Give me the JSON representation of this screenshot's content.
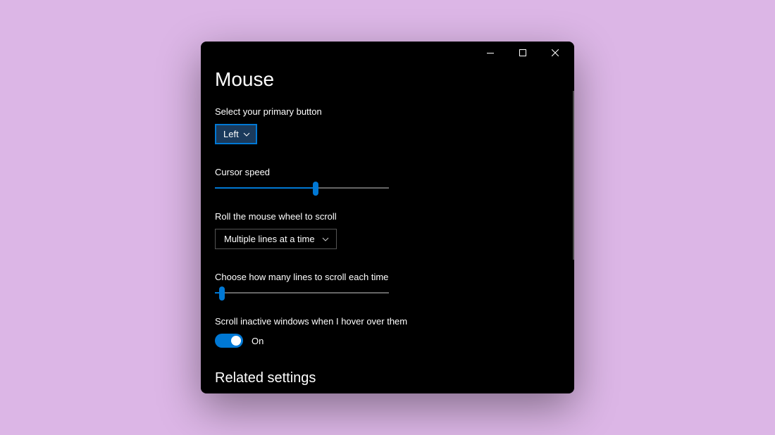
{
  "page": {
    "title": "Mouse"
  },
  "primary_button": {
    "label": "Select your primary button",
    "value": "Left"
  },
  "cursor_speed": {
    "label": "Cursor speed",
    "percent": 58
  },
  "wheel_scroll": {
    "label": "Roll the mouse wheel to scroll",
    "value": "Multiple lines at a time"
  },
  "lines_per_scroll": {
    "label": "Choose how many lines to scroll each time",
    "percent": 4
  },
  "inactive_scroll": {
    "label": "Scroll inactive windows when I hover over them",
    "state": "On"
  },
  "related": {
    "title": "Related settings"
  }
}
